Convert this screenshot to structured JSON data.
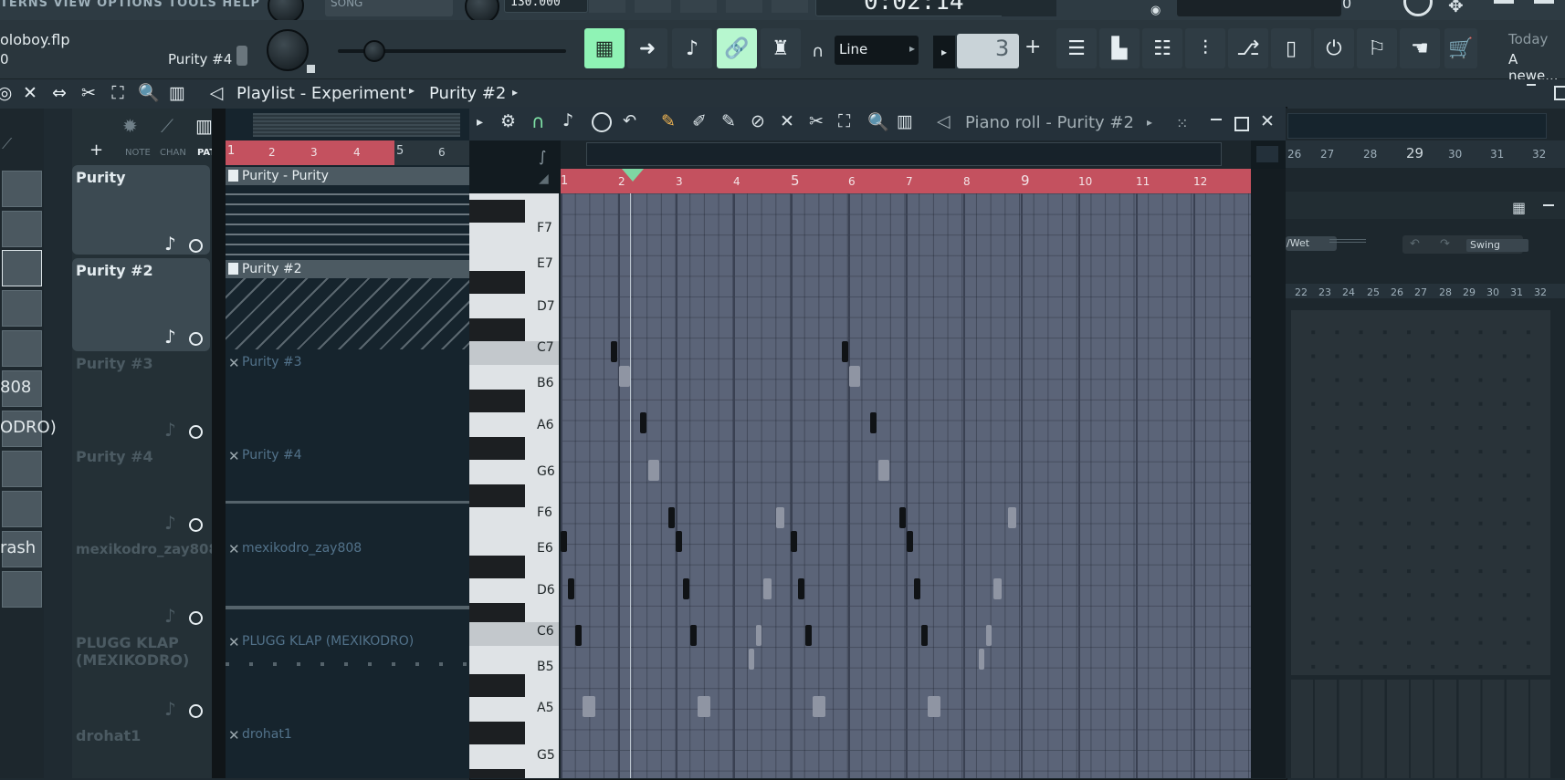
{
  "menu": {
    "text": "TERNS VIEW OPTIONS TOOLS HELP"
  },
  "transport": {
    "song_label": "SONG",
    "tempo": "130.000",
    "time": "0:02:14",
    "vol_value": "0"
  },
  "project": {
    "file": "oloboy.flp",
    "sub": "0",
    "hint": "Purity #4"
  },
  "snap": {
    "mode": "Line",
    "pattern_number": "3"
  },
  "news": {
    "title": "Today",
    "body": "A newe..."
  },
  "playlist": {
    "title": "Playlist - Experiment",
    "pattern": "Purity #2",
    "tabs": [
      "NOTE",
      "CHAN",
      "PAT"
    ],
    "ruler": [
      "1",
      "2",
      "3",
      "4",
      "5",
      "6"
    ]
  },
  "left_labels": [
    "808",
    "ODRO)",
    "rash"
  ],
  "tracks": [
    {
      "name": "Purity",
      "clip": "Purity - Purity",
      "state": "active"
    },
    {
      "name": "Purity #2",
      "clip": "Purity #2",
      "state": "active"
    },
    {
      "name": "Purity #3",
      "clip": "Purity #3",
      "state": "muted"
    },
    {
      "name": "Purity #4",
      "clip": "Purity #4",
      "state": "muted"
    },
    {
      "name": "mexikodro_zay808",
      "clip": "mexikodro_zay808",
      "state": "muted"
    },
    {
      "name": "PLUGG KLAP (MEXIKODRO)",
      "clip": "PLUGG KLAP (MEXIKODRO)",
      "state": "muted"
    },
    {
      "name": "drohat1",
      "clip": "drohat1",
      "state": "muted"
    }
  ],
  "piano_roll": {
    "title": "Piano roll - Purity #2",
    "ruler": [
      "1",
      "2",
      "3",
      "4",
      "5",
      "6",
      "7",
      "8",
      "9",
      "10",
      "11",
      "12"
    ],
    "keys": [
      "F7",
      "E7",
      "D7",
      "C7",
      "B6",
      "A6",
      "G6",
      "F6",
      "E6",
      "D6",
      "C6",
      "B5",
      "A5",
      "G5"
    ]
  },
  "right_panel": {
    "top_ruler": [
      "26",
      "27",
      "28",
      "29",
      "30",
      "31",
      "32"
    ],
    "steps": [
      "22",
      "23",
      "24",
      "25",
      "26",
      "27",
      "28",
      "29",
      "30",
      "31",
      "32"
    ],
    "drywet": "/Wet",
    "swing": "Swing"
  }
}
